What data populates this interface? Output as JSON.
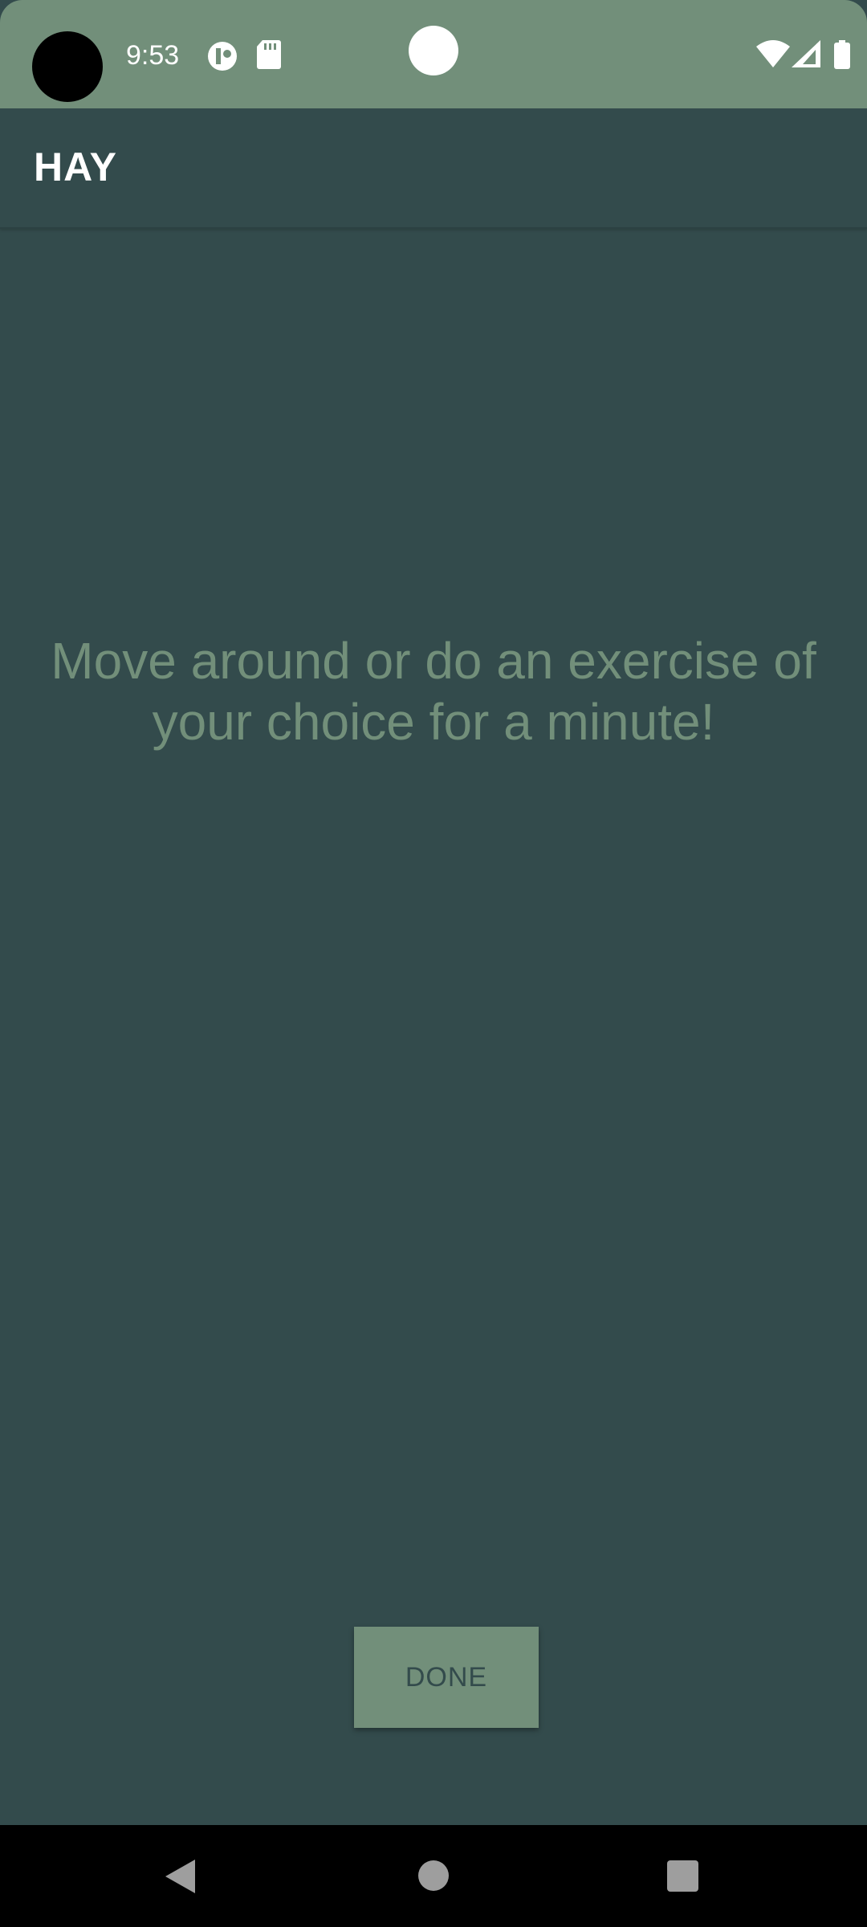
{
  "status_bar": {
    "time": "9:53",
    "icons": [
      "data-saver-icon",
      "sd-card-icon",
      "wifi-icon",
      "cell-signal-icon",
      "battery-icon"
    ],
    "background": "#728f7a"
  },
  "app_bar": {
    "title": "HAY"
  },
  "main": {
    "message": "Move around or do an exercise of your choice for a minute!",
    "done_label": "DONE"
  },
  "nav_bar": {
    "icons": [
      "back-icon",
      "home-icon",
      "recents-icon"
    ]
  },
  "colors": {
    "primary_dark": "#334b4c",
    "accent_green": "#728f7a",
    "text_light": "#ffffff"
  }
}
